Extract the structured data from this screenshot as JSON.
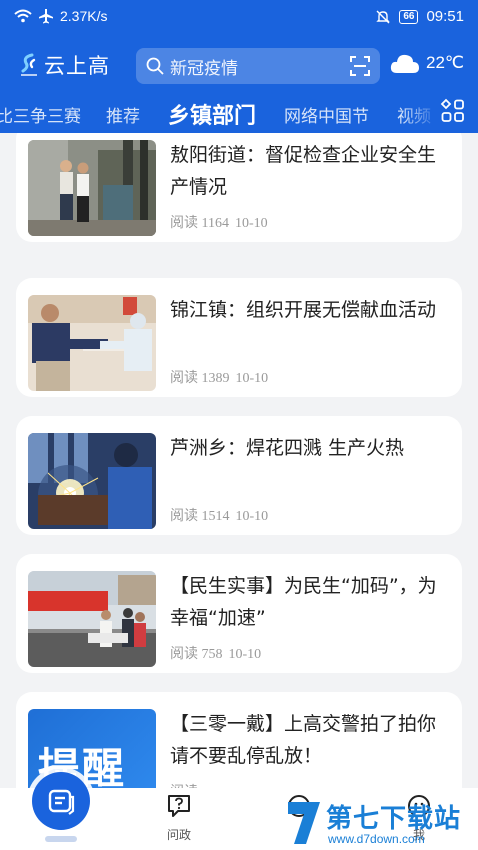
{
  "status_bar": {
    "net_speed": "2.37K/s",
    "battery": "66",
    "time": "09:51"
  },
  "app": {
    "name": "云上高"
  },
  "search": {
    "placeholder": "新冠疫情"
  },
  "weather": {
    "temp": "22℃",
    "icon": "cloud-icon"
  },
  "tabs": [
    {
      "label": "比三争三赛"
    },
    {
      "label": "推荐"
    },
    {
      "label": "乡镇部门",
      "active": true
    },
    {
      "label": "网络中国节"
    },
    {
      "label": "视频"
    }
  ],
  "articles": [
    {
      "title": "敖阳街道：督促检查企业安全生产情况",
      "reads": "阅读 1164",
      "date": "10-10"
    },
    {
      "title": "锦江镇：组织开展无偿献血活动",
      "reads": "阅读 1389",
      "date": "10-10"
    },
    {
      "title": "芦洲乡：焊花四溅 生产火热",
      "reads": "阅读 1514",
      "date": "10-10"
    },
    {
      "title": "【民生实事】为民生“加码”，为幸福“加速”",
      "reads": "阅读 758",
      "date": "10-10"
    },
    {
      "title": "【三零一戴】上高交警拍了拍你请不要乱停乱放！",
      "reads": "阅读",
      "date": "",
      "thumb_text": "提醒"
    }
  ],
  "bottom_nav": [
    {
      "label": "",
      "icon": "news-icon"
    },
    {
      "label": "问政",
      "icon": "question-icon"
    },
    {
      "label": "",
      "icon": "service-icon"
    },
    {
      "label": "我",
      "icon": "user-icon"
    }
  ],
  "watermark": {
    "title": "第七下载站",
    "url": "www.d7down.com"
  },
  "colors": {
    "brand_blue": "#1a63dd",
    "background": "#f2f3f5"
  }
}
